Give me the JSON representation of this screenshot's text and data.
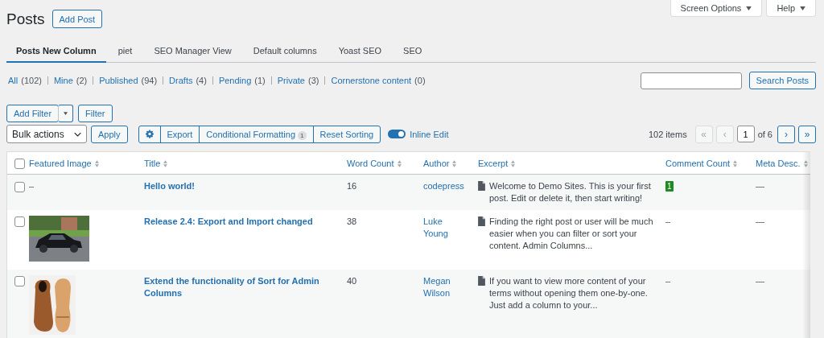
{
  "header": {
    "title": "Posts",
    "add_button": "Add Post",
    "screen_options": "Screen Options",
    "help": "Help"
  },
  "tabs": [
    {
      "label": "Posts New Column",
      "selected": true
    },
    {
      "label": "piet",
      "selected": false
    },
    {
      "label": "SEO Manager View",
      "selected": false
    },
    {
      "label": "Default columns",
      "selected": false
    },
    {
      "label": "Yoast SEO",
      "selected": false
    },
    {
      "label": "SEO",
      "selected": false
    }
  ],
  "status_links": [
    {
      "label": "All",
      "count": "(102)"
    },
    {
      "label": "Mine",
      "count": "(2)"
    },
    {
      "label": "Published",
      "count": "(94)"
    },
    {
      "label": "Drafts",
      "count": "(4)"
    },
    {
      "label": "Pending",
      "count": "(1)"
    },
    {
      "label": "Private",
      "count": "(3)"
    },
    {
      "label": "Cornerstone content",
      "count": "(0)"
    }
  ],
  "search": {
    "button": "Search Posts"
  },
  "filters": {
    "add_filter": "Add Filter",
    "filter": "Filter"
  },
  "toolbar": {
    "bulk_actions": "Bulk actions",
    "apply": "Apply",
    "export": "Export",
    "conditional_formatting": "Conditional Formatting",
    "conditional_count": "1",
    "reset_sorting": "Reset Sorting",
    "inline_edit": {
      "label": "Inline Edit",
      "on": true
    }
  },
  "pagination": {
    "items": "102 items",
    "first": {
      "label": "«",
      "disabled": true
    },
    "prev": {
      "label": "‹",
      "disabled": true
    },
    "page": "1",
    "of": "of 6",
    "next": {
      "label": "›",
      "disabled": false
    },
    "last": {
      "label": "»",
      "disabled": false
    }
  },
  "table": {
    "select_all": {
      "checked": false
    },
    "columns": [
      "Featured Image",
      "Title",
      "Word Count",
      "Author",
      "Excerpt",
      "Comment Count",
      "Meta Desc."
    ],
    "rows": [
      {
        "checked": false,
        "featured_image": {
          "kind": "none",
          "text": "–"
        },
        "title": "Hello world!",
        "word_count": "16",
        "author": "codepress",
        "excerpt": "Welcome to Demo Sites. This is your first post. Edit or delete it, then start writing!",
        "comment_count": {
          "kind": "badge",
          "text": "1"
        },
        "meta_desc": "—"
      },
      {
        "checked": false,
        "title": "Release 2.4: Export and Import changed",
        "word_count": "38",
        "author": "Luke Young",
        "excerpt": "Finding the right post or user will be much easier when you can filter or sort your content. Admin Columns...",
        "comment_count": {
          "kind": "plain",
          "text": "–"
        },
        "meta_desc": "—"
      },
      {
        "checked": false,
        "title": "Extend the functionality of Sort for Admin Columns",
        "word_count": "40",
        "author": "Megan Wilson",
        "excerpt": "If you want to view more content of your terms without opening them one-by-one. Just add a column to your...",
        "comment_count": {
          "kind": "plain",
          "text": "–"
        },
        "meta_desc": "—"
      }
    ]
  }
}
